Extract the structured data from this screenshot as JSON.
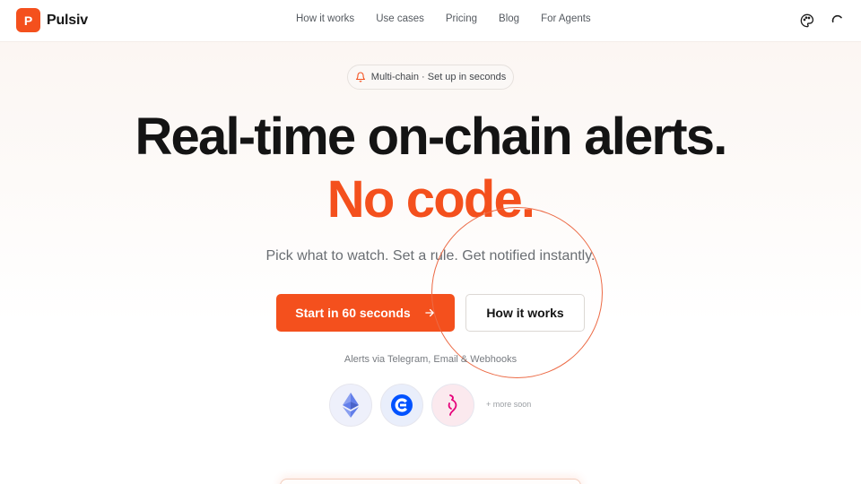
{
  "brand": {
    "logo_letter": "P",
    "name": "Pulsiv",
    "accent_color": "#f4501d"
  },
  "nav": {
    "items": [
      {
        "label": "How it works"
      },
      {
        "label": "Use cases"
      },
      {
        "label": "Pricing"
      },
      {
        "label": "Blog"
      },
      {
        "label": "For Agents"
      }
    ]
  },
  "header_icons": [
    "palette-icon",
    "loading-spinner-icon"
  ],
  "badge": {
    "icon": "bell-icon",
    "text": "Multi-chain · Set up in seconds"
  },
  "hero": {
    "headline": "Real-time on-chain alerts.",
    "headline_accent": "No code.",
    "subheadline": "Pick what to watch. Set a rule. Get notified instantly."
  },
  "cta": {
    "primary_label": "Start in 60 seconds",
    "primary_icon": "arrow-right-icon",
    "secondary_label": "How it works"
  },
  "alerts_via": "Alerts via Telegram, Email & Webhooks",
  "chains": [
    {
      "name": "ethereum",
      "icon": "ethereum-icon",
      "color": "#627eea"
    },
    {
      "name": "coinbase",
      "icon": "coinbase-icon",
      "color": "#0052ff"
    },
    {
      "name": "polkadot",
      "icon": "polkadot-icon",
      "color": "#e6007a"
    }
  ],
  "more_soon": "+ more soon"
}
